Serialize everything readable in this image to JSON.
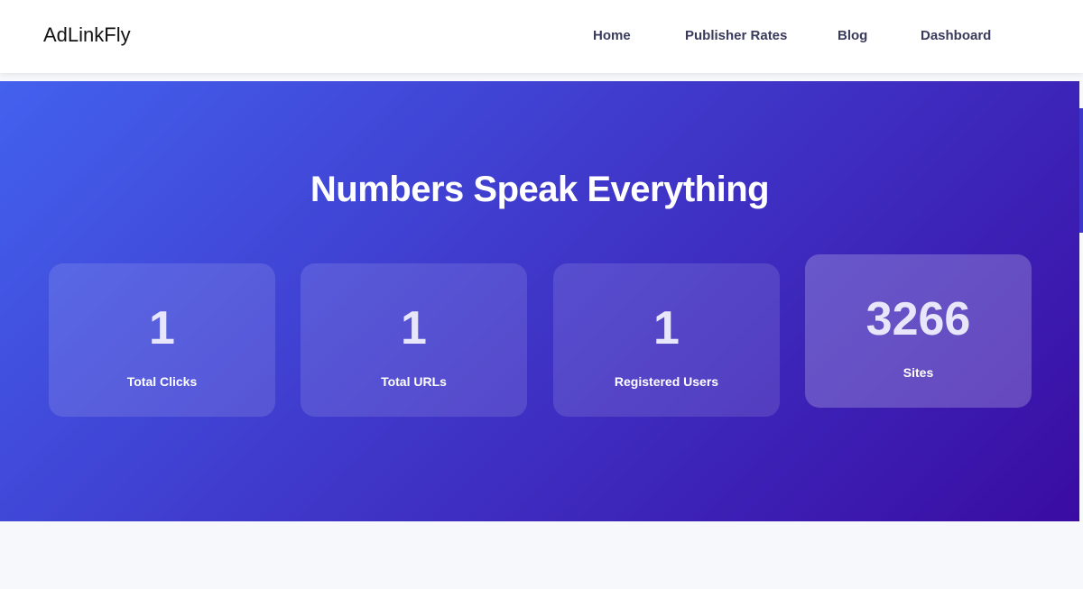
{
  "navbar": {
    "brand": "AdLinkFly",
    "links": [
      {
        "label": "Home"
      },
      {
        "label": "Publisher Rates"
      },
      {
        "label": "Blog"
      },
      {
        "label": "Dashboard"
      }
    ]
  },
  "hero": {
    "title": "Numbers Speak Everything",
    "stats": [
      {
        "value": "1",
        "label": "Total Clicks"
      },
      {
        "value": "1",
        "label": "Total URLs"
      },
      {
        "value": "1",
        "label": "Registered Users"
      },
      {
        "value": "3266",
        "label": "Sites"
      }
    ]
  },
  "colors": {
    "gradient_start": "#4361ee",
    "gradient_mid": "#3f37c9",
    "gradient_end": "#3a0ca3",
    "nav_text": "#3a3a5c",
    "page_background": "#f7f8fb"
  }
}
